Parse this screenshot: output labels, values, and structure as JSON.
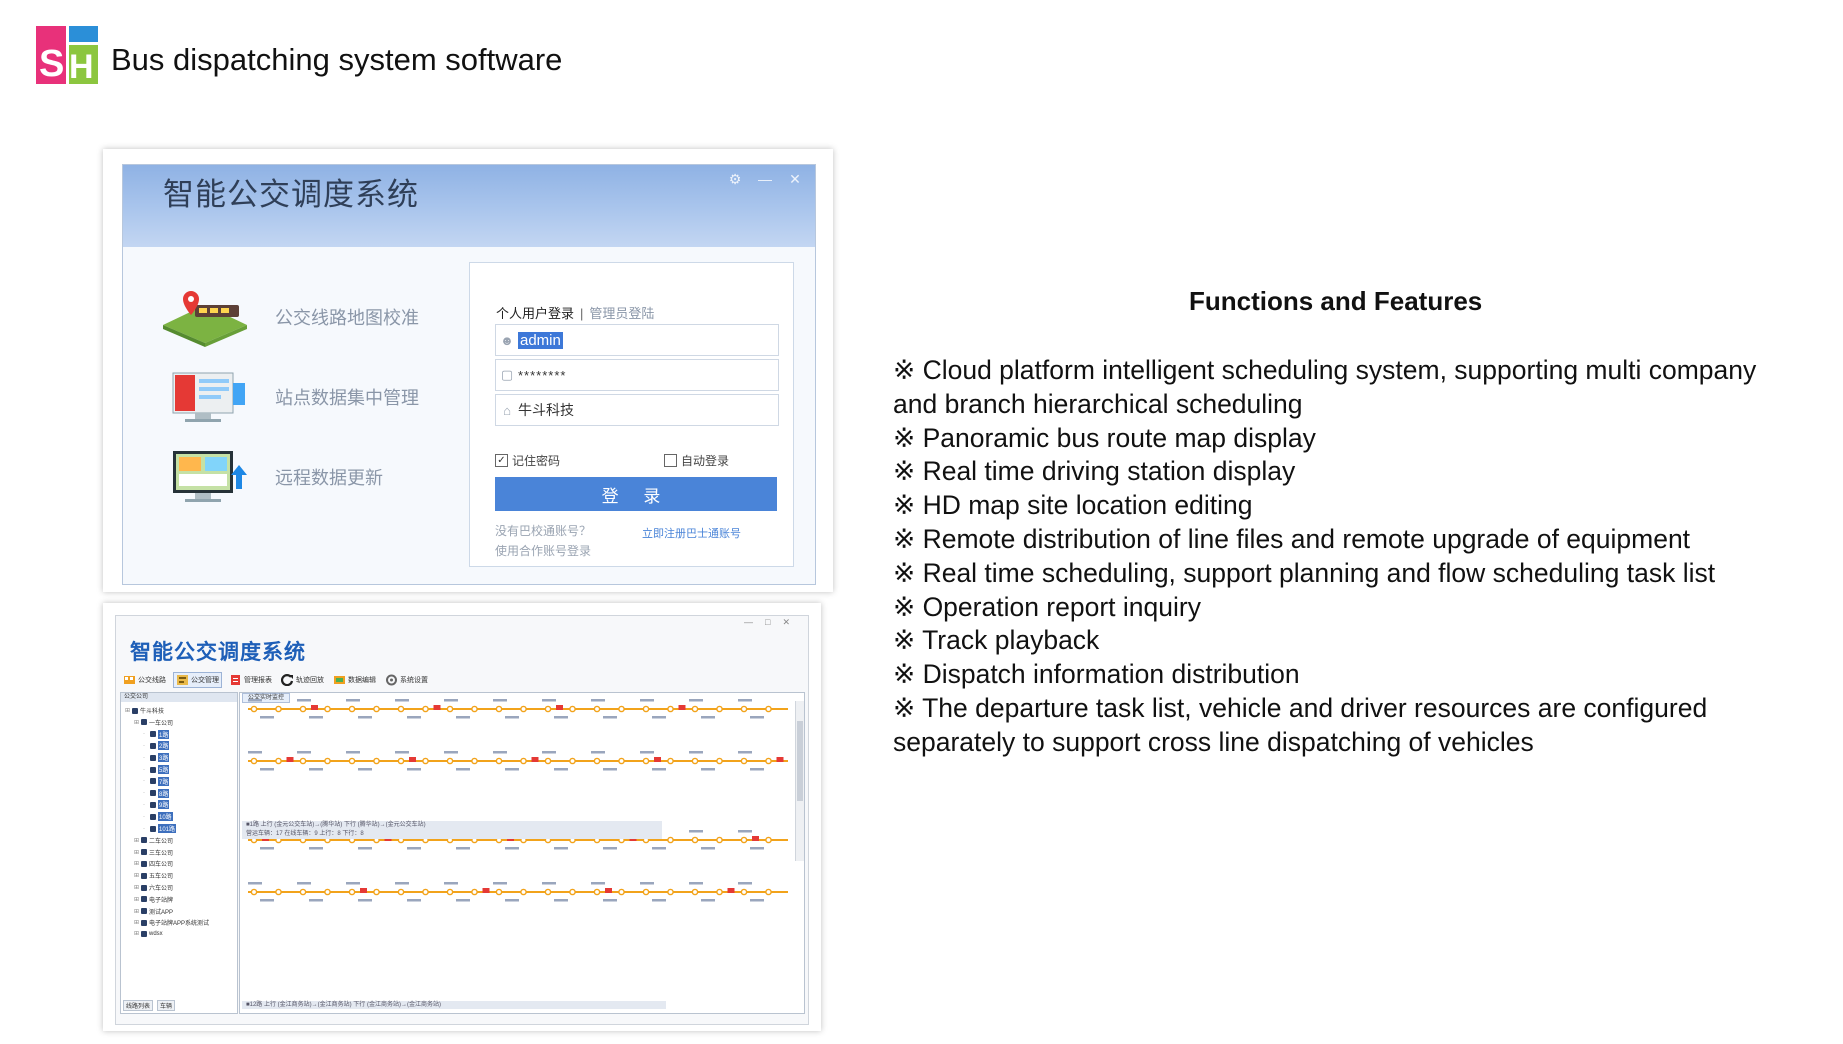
{
  "slide": {
    "logo_text": "SH",
    "title": "Bus dispatching system software",
    "colors": {
      "logo_pink": "#e8317a",
      "logo_blue": "#2b8fd8",
      "logo_green": "#8cc63f"
    }
  },
  "login_window": {
    "app_name": "智能公交调度系统",
    "window_controls": [
      "⚙",
      "—",
      "✕"
    ],
    "features": [
      {
        "icon": "route-map-icon",
        "label": "公交线路地图校准"
      },
      {
        "icon": "station-data-icon",
        "label": "站点数据集中管理"
      },
      {
        "icon": "remote-update-icon",
        "label": "远程数据更新"
      }
    ],
    "tab_personal": "个人用户登录",
    "tab_separator": "|",
    "tab_admin": "管理员登陆",
    "username_value": "admin",
    "password_value": "********",
    "company_value": "牛斗科技",
    "remember_password": "记住密码",
    "remember_checked": true,
    "auto_login": "自动登录",
    "auto_login_checked": false,
    "login_button": "登 录",
    "no_account_hint": "没有巴校通账号？",
    "register_link": "立即注册巴士通账号",
    "partner_login": "使用合作账号登录",
    "colors": {
      "header": "#9dbde9",
      "button": "#4a84d8"
    }
  },
  "dispatch_window": {
    "title": "智能公交调度系统",
    "toolbar": [
      "公交线路",
      "公交管理",
      "管理报表",
      "轨迹回放",
      "数据编辑",
      "系统设置"
    ],
    "tree_header": "公交公司",
    "tree": [
      {
        "label": "牛斗科技",
        "level": 0
      },
      {
        "label": "一车公司",
        "level": 1
      },
      {
        "label": "1路",
        "level": 2,
        "selected": true
      },
      {
        "label": "2路",
        "level": 2,
        "selected": true
      },
      {
        "label": "3路",
        "level": 2,
        "selected": true
      },
      {
        "label": "5路",
        "level": 2,
        "selected": true
      },
      {
        "label": "7路",
        "level": 2,
        "selected": true
      },
      {
        "label": "8路",
        "level": 2,
        "selected": true
      },
      {
        "label": "9路",
        "level": 2,
        "selected": true
      },
      {
        "label": "10路",
        "level": 2,
        "selected": true
      },
      {
        "label": "101路",
        "level": 2,
        "selected": true
      },
      {
        "label": "二车公司",
        "level": 1
      },
      {
        "label": "三车公司",
        "level": 1
      },
      {
        "label": "四车公司",
        "level": 1
      },
      {
        "label": "五车公司",
        "level": 1
      },
      {
        "label": "六车公司",
        "level": 1
      },
      {
        "label": "电子站牌",
        "level": 1
      },
      {
        "label": "测试APP",
        "level": 1
      },
      {
        "label": "电子站牌APP系统测试",
        "level": 1
      },
      {
        "label": "wdsx",
        "level": 1
      }
    ],
    "tree_footer": [
      "线路列表",
      "车辆"
    ],
    "route_tab": "公交实时监控",
    "status_1": "■1路  上行 (金元公交车站)→(腾华站)  下行 (腾华站)→(金元公交车站)",
    "status_2": "营运车辆：17   在线车辆：9   上行：8   下行：8",
    "status_3": "■12路  上行 (金江商务站)→(金江商务站)  下行 (金江商务站)→(金江商务站)",
    "route_color": "#f2a31b"
  },
  "features_panel": {
    "heading": "Functions and Features",
    "items": [
      "※ Cloud platform intelligent scheduling system, supporting multi company and branch hierarchical scheduling",
      "※ Panoramic bus route map display",
      "※ Real time driving station display",
      "※ HD map site location editing",
      "※ Remote distribution of line files and remote upgrade of equipment",
      "※ Real time scheduling, support planning and flow scheduling task list",
      "※ Operation report inquiry",
      "※ Track playback",
      "※ Dispatch information distribution",
      "※ The departure task list, vehicle and driver resources are configured separately to support cross line dispatching of vehicles"
    ]
  }
}
